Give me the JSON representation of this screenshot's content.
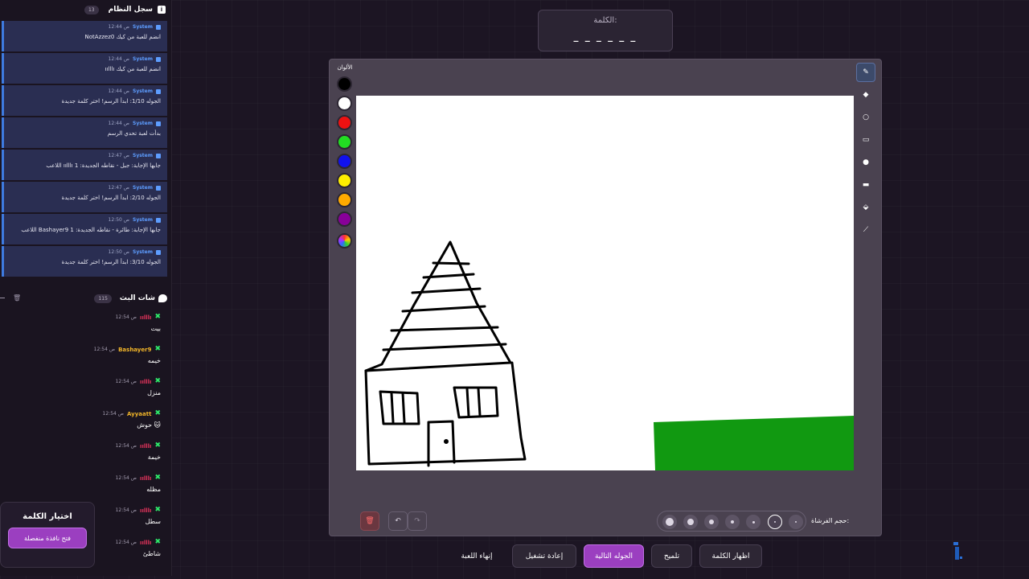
{
  "system_log": {
    "title": "سجل النظام",
    "count": "13",
    "entries": [
      {
        "sender": "System",
        "time": "12:44 ص",
        "message": "NotAzzez0 انضم للعبة من كيك"
      },
      {
        "sender": "System",
        "time": "12:44 ص",
        "message": "ıılllı انضم للعبة من كيك"
      },
      {
        "sender": "System",
        "time": "12:44 ص",
        "message": "الجوله 1/10: ابدأ الرسم! اختر كلمة جديدة"
      },
      {
        "sender": "System",
        "time": "12:44 ص",
        "message": "بدأت لعبة تحدي الرسم"
      },
      {
        "sender": "System",
        "time": "12:47 ص",
        "message": "اللاعب ıılllı جابها الإجابة: جبل - نقاطه الجديدة: 1"
      },
      {
        "sender": "System",
        "time": "12:47 ص",
        "message": "الجوله 2/10: ابدأ الرسم! اختر كلمة جديدة"
      },
      {
        "sender": "System",
        "time": "12:50 ص",
        "message": "اللاعب Bashayer9 جابها الإجابة: طائرة - نقاطه الجديدة: 1"
      },
      {
        "sender": "System",
        "time": "12:50 ص",
        "message": "الجوله 3/10: ابدأ الرسم! اختر كلمة جديدة"
      }
    ]
  },
  "chat": {
    "title": "شات البث",
    "count": "115",
    "messages": [
      {
        "user": "ıılllı",
        "user_color": "#e0335a",
        "time": "12:54 ص",
        "text": "بيت"
      },
      {
        "user": "Bashayer9",
        "user_color": "#f0b429",
        "time": "12:54 ص",
        "text": "خيمه"
      },
      {
        "user": "ıılllı",
        "user_color": "#e0335a",
        "time": "12:54 ص",
        "text": "منزل"
      },
      {
        "user": "Ayyaatt",
        "user_color": "#f0b429",
        "time": "12:54 ص",
        "text": "حوش 🐱"
      },
      {
        "user": "ıılllı",
        "user_color": "#e0335a",
        "time": "12:54 ص",
        "text": "خيمة"
      },
      {
        "user": "ıılllı",
        "user_color": "#e0335a",
        "time": "12:54 ص",
        "text": "مظله"
      },
      {
        "user": "ıılllı",
        "user_color": "#e0335a",
        "time": "12:54 ص",
        "text": "سطل"
      },
      {
        "user": "ıılllı",
        "user_color": "#e0335a",
        "time": "12:54 ص",
        "text": "شاطئ"
      }
    ]
  },
  "word_choice": {
    "title": "اختيار الكلمة",
    "button": "فتح نافذة منفصلة"
  },
  "word_box": {
    "label": "الكلمة:",
    "mask": "_ _ _ _ _ _"
  },
  "palette": {
    "label": "الألوان",
    "colors": [
      "#000000",
      "#ffffff",
      "#ee1111",
      "#22dd22",
      "#1111ee",
      "#ffee00",
      "#ffaa00",
      "#880099"
    ],
    "custom_icon": "rainbow-color-icon"
  },
  "tools": [
    {
      "icon": "pencil-icon",
      "glyph": "✎",
      "active": true
    },
    {
      "icon": "eraser-icon",
      "glyph": "◆",
      "active": false
    },
    {
      "icon": "circle-icon",
      "glyph": "○",
      "active": false
    },
    {
      "icon": "rectangle-icon",
      "glyph": "▭",
      "active": false
    },
    {
      "icon": "filled-circle-icon",
      "glyph": "●",
      "active": false
    },
    {
      "icon": "filled-rectangle-icon",
      "glyph": "▬",
      "active": false
    },
    {
      "icon": "fill-bucket-icon",
      "glyph": "⬙",
      "active": false
    },
    {
      "icon": "line-icon",
      "glyph": "⟋",
      "active": false
    }
  ],
  "controls": {
    "brush_label": "حجم الفرشاة:",
    "delete_icon": "trash-icon",
    "undo_icon": "undo-icon",
    "redo_icon": "redo-icon",
    "undo_glyph": "↶",
    "redo_glyph": "↷",
    "delete_glyph": "🗑"
  },
  "actions": {
    "end_game": "إنهاء اللعبة",
    "restart": "إعادة تشغيل",
    "next_round": "الجوله التالية",
    "hint": "تلميح",
    "show_word": "اظهار الكلمة"
  },
  "accent_colors": {
    "primary_purple": "#9b3fc0",
    "system_blue": "#3e7be0",
    "grass_green": "#119911"
  }
}
